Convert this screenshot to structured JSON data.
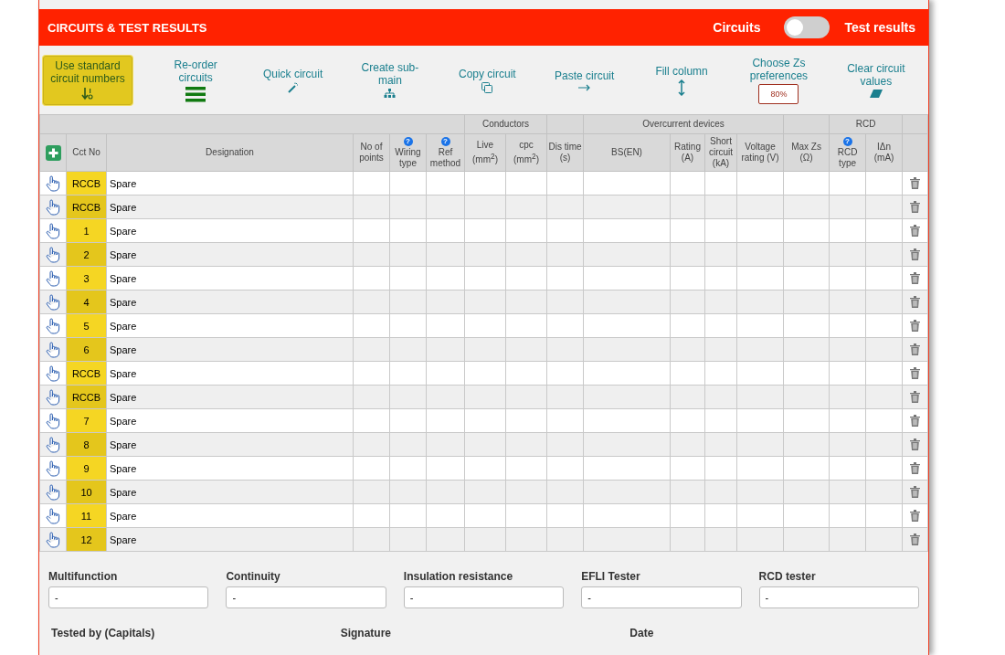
{
  "header": {
    "title": "CIRCUITS & TEST RESULTS",
    "toggle": {
      "left_label": "Circuits",
      "right_label": "Test results",
      "on": false
    }
  },
  "toolbar": [
    {
      "label": "Use standard circuit numbers",
      "kind": "primary"
    },
    {
      "label": "Re-order circuits",
      "kind": "link"
    },
    {
      "label": "Quick circuit",
      "kind": "link"
    },
    {
      "label": "Create sub-main",
      "kind": "link"
    },
    {
      "label": "Copy circuit",
      "kind": "link"
    },
    {
      "label": "Paste circuit",
      "kind": "link"
    },
    {
      "label": "Fill column",
      "kind": "link"
    },
    {
      "label": "Choose Zs preferences",
      "kind": "link",
      "badge": "80%"
    },
    {
      "label": "Clear circuit values",
      "kind": "link"
    }
  ],
  "table": {
    "column_groups": [
      {
        "columns": [
          {
            "kind": "add"
          },
          {
            "label": "Cct No",
            "kind": "cct"
          },
          {
            "label": "Designation",
            "kind": "designation"
          },
          {
            "label": "No of points",
            "kind": "text"
          },
          {
            "label": "Wiring type",
            "kind": "text",
            "help": "?"
          },
          {
            "label": "Ref method",
            "kind": "text",
            "help": "?"
          }
        ]
      },
      {
        "label": "Conductors",
        "columns": [
          {
            "label": "Live (mm$^{2}$)",
            "kind": "text"
          },
          {
            "label": "cpc (mm$^{2}$)",
            "kind": "text"
          }
        ]
      },
      {
        "columns": [
          {
            "label": "Dis time (s)",
            "kind": "text"
          }
        ]
      },
      {
        "label": "Overcurrent devices",
        "columns": [
          {
            "label": "BS(EN)",
            "kind": "text"
          },
          {
            "label": "Rating (A)",
            "kind": "text"
          },
          {
            "label": "Short circuit (kA)",
            "kind": "text"
          },
          {
            "label": "Voltage rating (V)",
            "kind": "text"
          }
        ]
      },
      {
        "columns": [
          {
            "label": "Max Zs (Ω)",
            "kind": "text"
          }
        ]
      },
      {
        "label": "RCD",
        "columns": [
          {
            "label": "RCD type",
            "kind": "text",
            "help": "?"
          },
          {
            "label": "IΔn (mA)",
            "kind": "text"
          }
        ]
      },
      {
        "columns": [
          {
            "kind": "delete"
          }
        ]
      }
    ],
    "rows": [
      {
        "cct": "RCCB",
        "designation": "Spare"
      },
      {
        "cct": "RCCB",
        "designation": "Spare"
      },
      {
        "cct": "1",
        "designation": "Spare"
      },
      {
        "cct": "2",
        "designation": "Spare"
      },
      {
        "cct": "3",
        "designation": "Spare"
      },
      {
        "cct": "4",
        "designation": "Spare"
      },
      {
        "cct": "5",
        "designation": "Spare"
      },
      {
        "cct": "6",
        "designation": "Spare"
      },
      {
        "cct": "RCCB",
        "designation": "Spare"
      },
      {
        "cct": "RCCB",
        "designation": "Spare"
      },
      {
        "cct": "7",
        "designation": "Spare"
      },
      {
        "cct": "8",
        "designation": "Spare"
      },
      {
        "cct": "9",
        "designation": "Spare"
      },
      {
        "cct": "10",
        "designation": "Spare"
      },
      {
        "cct": "11",
        "designation": "Spare"
      },
      {
        "cct": "12",
        "designation": "Spare"
      }
    ]
  },
  "testers": [
    {
      "label": "Multifunction",
      "value": "-"
    },
    {
      "label": "Continuity",
      "value": "-"
    },
    {
      "label": "Insulation resistance",
      "value": "-"
    },
    {
      "label": "EFLI Tester",
      "value": "-"
    },
    {
      "label": "RCD tester",
      "value": "-"
    }
  ],
  "signoff": [
    {
      "label": "Tested by (Capitals)"
    },
    {
      "label": "Signature"
    },
    {
      "label": "Date"
    }
  ]
}
